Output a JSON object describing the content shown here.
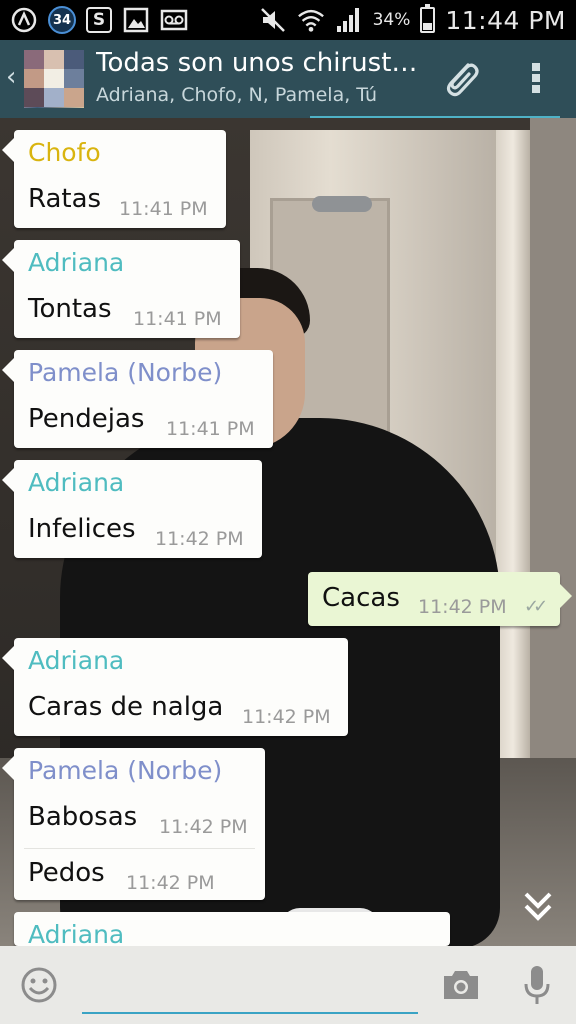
{
  "status_bar": {
    "notification_count": "34",
    "battery_percent": "34%",
    "battery_level": 0.34,
    "time": "11:44 PM",
    "icons": [
      "whatsapp-icon",
      "notification-badge",
      "skype-icon",
      "gallery-icon",
      "voicemail-icon",
      "mute-icon",
      "wifi-icon",
      "signal-icon",
      "battery-icon"
    ]
  },
  "header": {
    "title": "Todas son unos chirust…",
    "subtitle": "Adriana, Chofo, N, Pamela, Tú"
  },
  "colors": {
    "chofo": "#d9b40f",
    "adriana": "#4fbcc0",
    "pamela": "#7f8fca",
    "header_bg": "#2f4e58",
    "accent": "#3aa3c4"
  },
  "messages": [
    {
      "sender": "Chofo",
      "text": "Ratas",
      "time": "11:41 PM",
      "direction": "in"
    },
    {
      "sender": "Adriana",
      "text": "Tontas",
      "time": "11:41 PM",
      "direction": "in"
    },
    {
      "sender": "Pamela (Norbe)",
      "text": "Pendejas",
      "time": "11:41 PM",
      "direction": "in"
    },
    {
      "sender": "Adriana",
      "text": "Infelices",
      "time": "11:42 PM",
      "direction": "in"
    },
    {
      "sender": "",
      "text": "Cacas",
      "time": "11:42 PM",
      "direction": "out",
      "status": "✓✓"
    },
    {
      "sender": "Adriana",
      "text": "Caras de nalga",
      "time": "11:42 PM",
      "direction": "in"
    },
    {
      "sender": "Pamela (Norbe)",
      "text": "Babosas",
      "time": "11:42 PM",
      "direction": "in",
      "extra_text": "Pedos",
      "extra_time": "11:42 PM"
    },
    {
      "sender": "Adriana",
      "text": "",
      "time": "",
      "direction": "in"
    }
  ],
  "input": {
    "placeholder": ""
  }
}
